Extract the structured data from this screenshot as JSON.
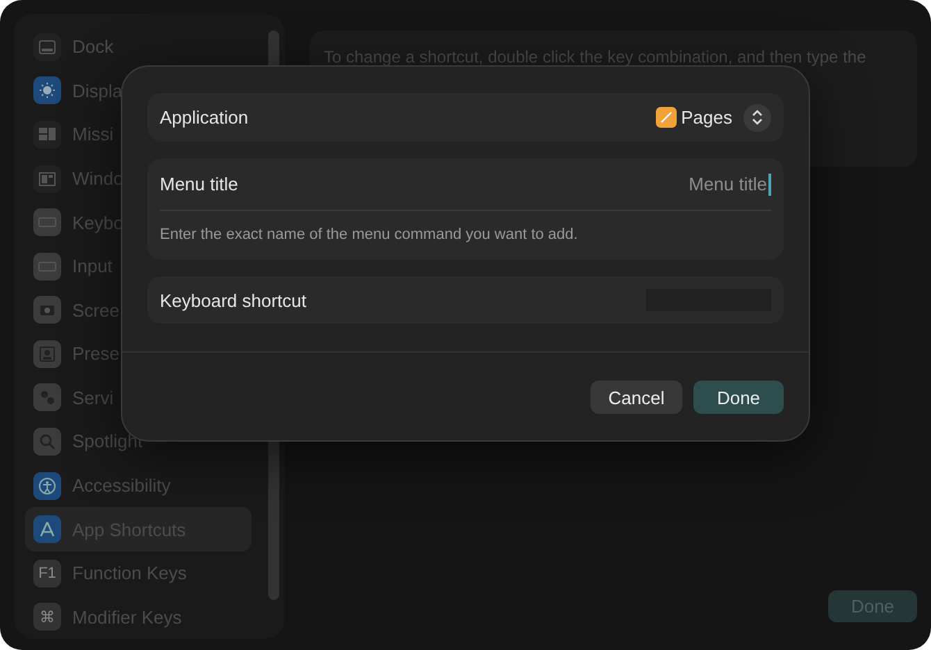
{
  "sidebar": {
    "items": [
      {
        "label": "Dock",
        "kind": "dock",
        "selected": false
      },
      {
        "label": "Displa",
        "kind": "display",
        "selected": false
      },
      {
        "label": "Missi",
        "kind": "mission",
        "selected": false
      },
      {
        "label": "Windo",
        "kind": "window",
        "selected": false
      },
      {
        "label": "Keybo",
        "kind": "keyboard",
        "selected": false
      },
      {
        "label": "Input",
        "kind": "keyboard",
        "selected": false
      },
      {
        "label": "Scree",
        "kind": "camera",
        "selected": false
      },
      {
        "label": "Prese",
        "kind": "person",
        "selected": false
      },
      {
        "label": "Servi",
        "kind": "gears",
        "selected": false
      },
      {
        "label": "Spotlight",
        "kind": "search",
        "selected": false
      },
      {
        "label": "Accessibility",
        "kind": "accessibility",
        "selected": false
      },
      {
        "label": "App Shortcuts",
        "kind": "appstore",
        "selected": true
      },
      {
        "label": "Function Keys",
        "kind": "text",
        "icon_text": "F1",
        "selected": false
      },
      {
        "label": "Modifier Keys",
        "kind": "text",
        "icon_text": "⌘",
        "selected": false
      }
    ]
  },
  "content": {
    "description": "To change a shortcut, double click the key combination, and then type the",
    "done_button": "Done"
  },
  "dialog": {
    "application": {
      "label": "Application",
      "value": "Pages"
    },
    "menu_title": {
      "label": "Menu title",
      "placeholder": "Menu title",
      "focused": true,
      "hint": "Enter the exact name of the menu command you want to add."
    },
    "keyboard_shortcut": {
      "label": "Keyboard shortcut"
    },
    "buttons": [
      {
        "label": "Cancel",
        "kind": "secondary"
      },
      {
        "label": "Done",
        "kind": "primary"
      }
    ]
  }
}
